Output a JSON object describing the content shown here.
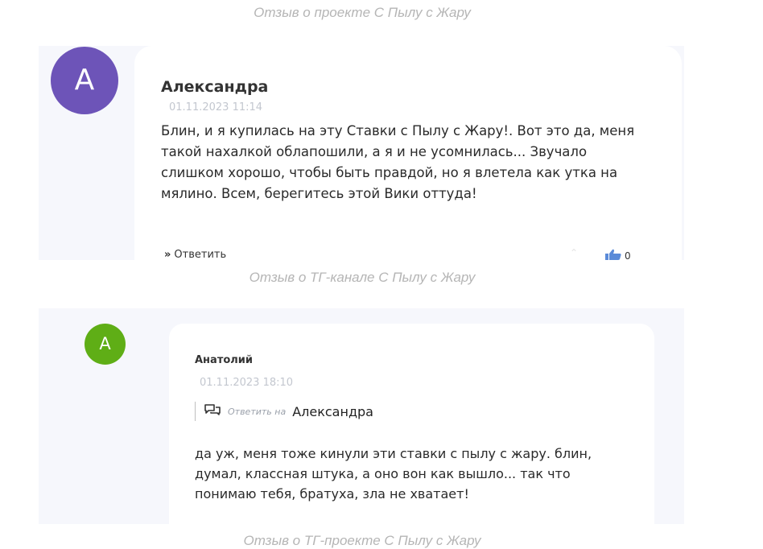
{
  "captions": {
    "first": "Отзыв о проекте С Пылу с Жару",
    "second": "Отзыв о ТГ-канале С Пылу с Жару",
    "third": "Отзыв о ТГ-проекте С Пылу с Жару"
  },
  "review1": {
    "avatar_letter": "A",
    "avatar_color": "#6d54b8",
    "author": "Александра",
    "date": "01.11.2023 11:14",
    "text": "Блин, и я купилась на эту Ставки с Пылу с Жару!. Вот это да, меня такой нахалкой облапошили, а я и не усомнилась... Звучало слишком хорошо, чтобы быть правдой, но я влетела как утка на мялино. Всем, берегитесь этой Вики оттуда!",
    "reply_label": "Ответить",
    "reply_icon": "double-chevron-right-icon",
    "likes": "0",
    "like_icon": "thumbs-up-icon",
    "like_color": "#5b8bd8"
  },
  "review2": {
    "avatar_letter": "A",
    "avatar_color": "#5fae16",
    "author": "Анатолий",
    "date": "01.11.2023 18:10",
    "reply_to_label": "Ответить на",
    "reply_to_name": "Александра",
    "reply_to_icon": "chat-bubbles-icon",
    "text": "да уж, меня тоже кинули эти ставки с пылу с жару. блин, думал, классная штука, а оно вон как вышло... так что понимаю тебя, братуха, зла не хватает!"
  }
}
